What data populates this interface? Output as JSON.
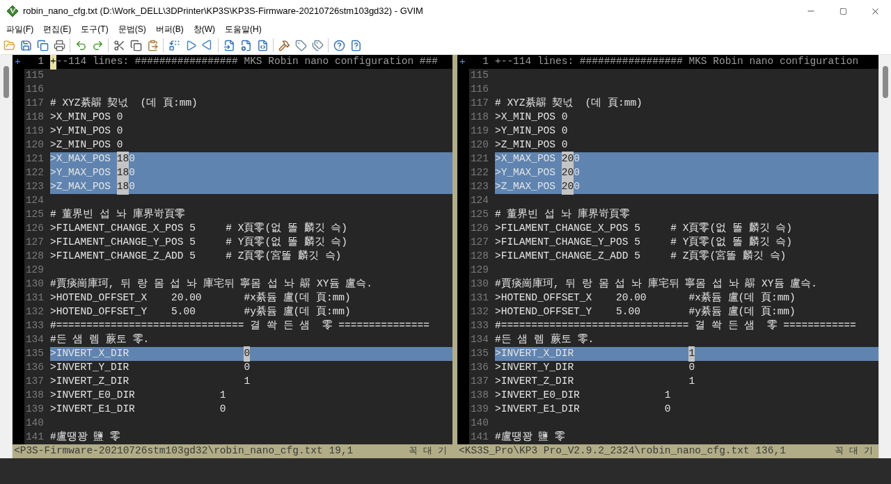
{
  "window": {
    "title": "robin_nano_cfg.txt (D:\\Work_DELL\\3DPrinter\\KP3S\\KP3S-Firmware-20210726stm103gd32) - GVIM"
  },
  "menu": [
    "파일(F)",
    "편집(E)",
    "도구(T)",
    "문법(S)",
    "버퍼(B)",
    "창(W)",
    "도움말(H)"
  ],
  "panes": [
    {
      "fold": {
        "sign": "+",
        "number": "1",
        "cursor_char": "+",
        "text": "--114 lines: ################# MKS Robin nano configuration ###"
      },
      "lines": [
        {
          "number": "115",
          "diff": false
        },
        {
          "number": "116",
          "diff": false
        },
        {
          "number": "117",
          "diff": false,
          "segments": [
            {
              "text": "# XYZ綦髜 契넋  (데 頁:mm)",
              "changed": false
            }
          ]
        },
        {
          "number": "118",
          "diff": false,
          "segments": [
            {
              "text": ">X_MIN_POS 0",
              "changed": false
            }
          ]
        },
        {
          "number": "119",
          "diff": false,
          "segments": [
            {
              "text": ">Y_MIN_POS 0",
              "changed": false
            }
          ]
        },
        {
          "number": "120",
          "diff": false,
          "segments": [
            {
              "text": ">Z_MIN_POS 0",
              "changed": false
            }
          ]
        },
        {
          "number": "121",
          "diff": true,
          "segments": [
            {
              "text": ">X_MAX_POS ",
              "changed": false
            },
            {
              "text": "18",
              "changed": true
            },
            {
              "text": "0",
              "changed": false
            }
          ]
        },
        {
          "number": "122",
          "diff": true,
          "segments": [
            {
              "text": ">Y_MAX_POS ",
              "changed": false
            },
            {
              "text": "18",
              "changed": true
            },
            {
              "text": "0",
              "changed": false
            }
          ]
        },
        {
          "number": "123",
          "diff": true,
          "segments": [
            {
              "text": ">Z_MAX_POS ",
              "changed": false
            },
            {
              "text": "18",
              "changed": true
            },
            {
              "text": "0",
              "changed": false
            }
          ]
        },
        {
          "number": "124",
          "diff": false
        },
        {
          "number": "125",
          "diff": false,
          "segments": [
            {
              "text": "# 董界빈 섭 놔 庫界岢頁零",
              "changed": false
            }
          ]
        },
        {
          "number": "126",
          "diff": false,
          "segments": [
            {
              "text": ">FILAMENT_CHANGE_X_POS 5     # X頁零(없 똘 麟깃 슥)",
              "changed": false
            }
          ]
        },
        {
          "number": "127",
          "diff": false,
          "segments": [
            {
              "text": ">FILAMENT_CHANGE_Y_POS 5     # Y頁零(없 똘 麟깃 슥)",
              "changed": false
            }
          ]
        },
        {
          "number": "128",
          "diff": false,
          "segments": [
            {
              "text": ">FILAMENT_CHANGE_Z_ADD 5     # Z頁零(宮똘 麟깃 슥)",
              "changed": false
            }
          ]
        },
        {
          "number": "129",
          "diff": false
        },
        {
          "number": "130",
          "diff": false,
          "segments": [
            {
              "text": "#賈痰崗庫珂, 뒤 랑 몸 섭 놔 庫宅뒤 寧몸 섭 놔 髜 XY듐 盧슥.",
              "changed": false
            }
          ]
        },
        {
          "number": "131",
          "diff": false,
          "segments": [
            {
              "text": ">HOTEND_OFFSET_X    20.00       #x綦듐 盧(데 頁:mm)",
              "changed": false
            }
          ]
        },
        {
          "number": "132",
          "diff": false,
          "segments": [
            {
              "text": ">HOTEND_OFFSET_Y    5.00        #y綦듐 盧(데 頁:mm)",
              "changed": false
            }
          ]
        },
        {
          "number": "133",
          "diff": false,
          "segments": [
            {
              "text": "#=============================== 결 쏵 든 샘  零 ===============",
              "changed": false
            }
          ]
        },
        {
          "number": "134",
          "diff": false,
          "segments": [
            {
              "text": "#든 샘 렘 蕨토 零.",
              "changed": false
            }
          ]
        },
        {
          "number": "135",
          "diff": true,
          "segments": [
            {
              "text": ">INVERT_X_DIR                   ",
              "changed": false
            },
            {
              "text": "0",
              "changed": true
            }
          ]
        },
        {
          "number": "136",
          "diff": false,
          "segments": [
            {
              "text": ">INVERT_Y_DIR                   0",
              "changed": false
            }
          ]
        },
        {
          "number": "137",
          "diff": false,
          "segments": [
            {
              "text": ">INVERT_Z_DIR                   1",
              "changed": false
            }
          ]
        },
        {
          "number": "138",
          "diff": false,
          "segments": [
            {
              "text": ">INVERT_E0_DIR              1",
              "changed": false
            }
          ]
        },
        {
          "number": "139",
          "diff": false,
          "segments": [
            {
              "text": ">INVERT_E1_DIR              0",
              "changed": false
            }
          ]
        },
        {
          "number": "140",
          "diff": false
        },
        {
          "number": "141",
          "diff": false,
          "segments": [
            {
              "text": "#盧땡꽝 鹽 零",
              "changed": false
            }
          ]
        }
      ],
      "status": {
        "path": "<P3S-Firmware-20210726stm103gd32\\robin_nano_cfg.txt 19,1",
        "position": "꼭 대 기"
      }
    },
    {
      "fold": {
        "sign": "+",
        "number": "1",
        "text": "+--114 lines: ################# MKS Robin nano configuration"
      },
      "lines": [
        {
          "number": "115",
          "diff": false
        },
        {
          "number": "116",
          "diff": false
        },
        {
          "number": "117",
          "diff": false,
          "segments": [
            {
              "text": "# XYZ綦髜 契넋  (데 頁:mm)",
              "changed": false
            }
          ]
        },
        {
          "number": "118",
          "diff": false,
          "segments": [
            {
              "text": ">X_MIN_POS 0",
              "changed": false
            }
          ]
        },
        {
          "number": "119",
          "diff": false,
          "segments": [
            {
              "text": ">Y_MIN_POS 0",
              "changed": false
            }
          ]
        },
        {
          "number": "120",
          "diff": false,
          "segments": [
            {
              "text": ">Z_MIN_POS 0",
              "changed": false
            }
          ]
        },
        {
          "number": "121",
          "diff": true,
          "segments": [
            {
              "text": ">X_MAX_POS ",
              "changed": false
            },
            {
              "text": "20",
              "changed": true
            },
            {
              "text": "0",
              "changed": false
            }
          ]
        },
        {
          "number": "122",
          "diff": true,
          "segments": [
            {
              "text": ">Y_MAX_POS ",
              "changed": false
            },
            {
              "text": "20",
              "changed": true
            },
            {
              "text": "0",
              "changed": false
            }
          ]
        },
        {
          "number": "123",
          "diff": true,
          "segments": [
            {
              "text": ">Z_MAX_POS ",
              "changed": false
            },
            {
              "text": "20",
              "changed": true
            },
            {
              "text": "0",
              "changed": false
            }
          ]
        },
        {
          "number": "124",
          "diff": false
        },
        {
          "number": "125",
          "diff": false,
          "segments": [
            {
              "text": "# 董界빈 섭 놔 庫界岢頁零",
              "changed": false
            }
          ]
        },
        {
          "number": "126",
          "diff": false,
          "segments": [
            {
              "text": ">FILAMENT_CHANGE_X_POS 5     # X頁零(없 똘 麟깃 슥)",
              "changed": false
            }
          ]
        },
        {
          "number": "127",
          "diff": false,
          "segments": [
            {
              "text": ">FILAMENT_CHANGE_Y_POS 5     # Y頁零(없 똘 麟깃 슥)",
              "changed": false
            }
          ]
        },
        {
          "number": "128",
          "diff": false,
          "segments": [
            {
              "text": ">FILAMENT_CHANGE_Z_ADD 5     # Z頁零(宮똘 麟깃 슥)",
              "changed": false
            }
          ]
        },
        {
          "number": "129",
          "diff": false
        },
        {
          "number": "130",
          "diff": false,
          "segments": [
            {
              "text": "#賈痰崗庫珂, 뒤 랑 몸 섭 놔 庫宅뒤 寧몸 섭 놔 髜 XY듐 盧슥.",
              "changed": false
            }
          ]
        },
        {
          "number": "131",
          "diff": false,
          "segments": [
            {
              "text": ">HOTEND_OFFSET_X    20.00       #x綦듐 盧(데 頁:mm)",
              "changed": false
            }
          ]
        },
        {
          "number": "132",
          "diff": false,
          "segments": [
            {
              "text": ">HOTEND_OFFSET_Y    5.00        #y綦듐 盧(데 頁:mm)",
              "changed": false
            }
          ]
        },
        {
          "number": "133",
          "diff": false,
          "segments": [
            {
              "text": "#=============================== 결 쏵 든 샘  零 ============",
              "changed": false
            }
          ]
        },
        {
          "number": "134",
          "diff": false,
          "segments": [
            {
              "text": "#든 샘 렘 蕨토 零.",
              "changed": false
            }
          ]
        },
        {
          "number": "135",
          "diff": true,
          "segments": [
            {
              "text": ">INVERT_X_DIR                   ",
              "changed": false
            },
            {
              "text": "1",
              "changed": true
            }
          ]
        },
        {
          "number": "136",
          "diff": false,
          "segments": [
            {
              "text": ">INVERT_Y_DIR                   0",
              "changed": false
            }
          ]
        },
        {
          "number": "137",
          "diff": false,
          "segments": [
            {
              "text": ">INVERT_Z_DIR                   1",
              "changed": false
            }
          ]
        },
        {
          "number": "138",
          "diff": false,
          "segments": [
            {
              "text": ">INVERT_E0_DIR              1",
              "changed": false
            }
          ]
        },
        {
          "number": "139",
          "diff": false,
          "segments": [
            {
              "text": ">INVERT_E1_DIR              0",
              "changed": false
            }
          ]
        },
        {
          "number": "140",
          "diff": false
        },
        {
          "number": "141",
          "diff": false,
          "segments": [
            {
              "text": "#盧땡꽝 鹽 零",
              "changed": false
            }
          ]
        }
      ],
      "status": {
        "path": "<KS3S_Pro\\KP3 Pro_V2.9.2_2324\\robin_nano_cfg.txt 136,1",
        "position": "꼭 대 기"
      }
    }
  ]
}
